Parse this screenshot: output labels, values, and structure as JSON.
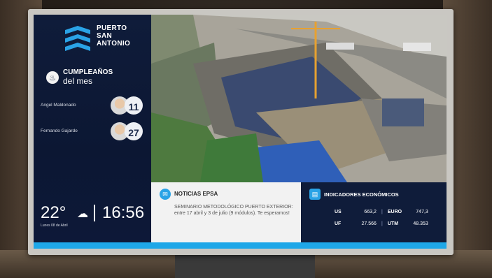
{
  "brand": {
    "line1": "PUERTO",
    "line2": "SAN",
    "line3": "ANTONIO"
  },
  "birthdays": {
    "title": "CUMPLEAÑOS",
    "subtitle": "del mes",
    "items": [
      {
        "name": "Angel Maldonado",
        "day": "11"
      },
      {
        "name": "Fernando Gajardo",
        "day": "27"
      }
    ]
  },
  "weather": {
    "temperature": "22°",
    "icon": "partly-cloudy-icon",
    "time": "16:56",
    "date": "Lunes 08 de Abril"
  },
  "news": {
    "icon": "news-icon",
    "title_prefix": "NOTICIAS",
    "title_suffix": "EPSA",
    "text": "SEMINARIO METODOLÓGICO PUERTO EXTERIOR: entre 17 abril y 3 de julio (9 módulos). Te esperamos!"
  },
  "indicators": {
    "icon": "chart-icon",
    "title": "INDICADORES ECONÓMICOS",
    "rows": [
      {
        "a_label": "US",
        "a_value": "663,2",
        "b_label": "EURO",
        "b_value": "747,3"
      },
      {
        "a_label": "UF",
        "a_value": "27.566",
        "b_label": "UTM",
        "b_value": "48.353"
      }
    ]
  },
  "colors": {
    "navy": "#0f1c3a",
    "accent": "#1ea7e8",
    "panel_light": "#f2f2f2"
  }
}
